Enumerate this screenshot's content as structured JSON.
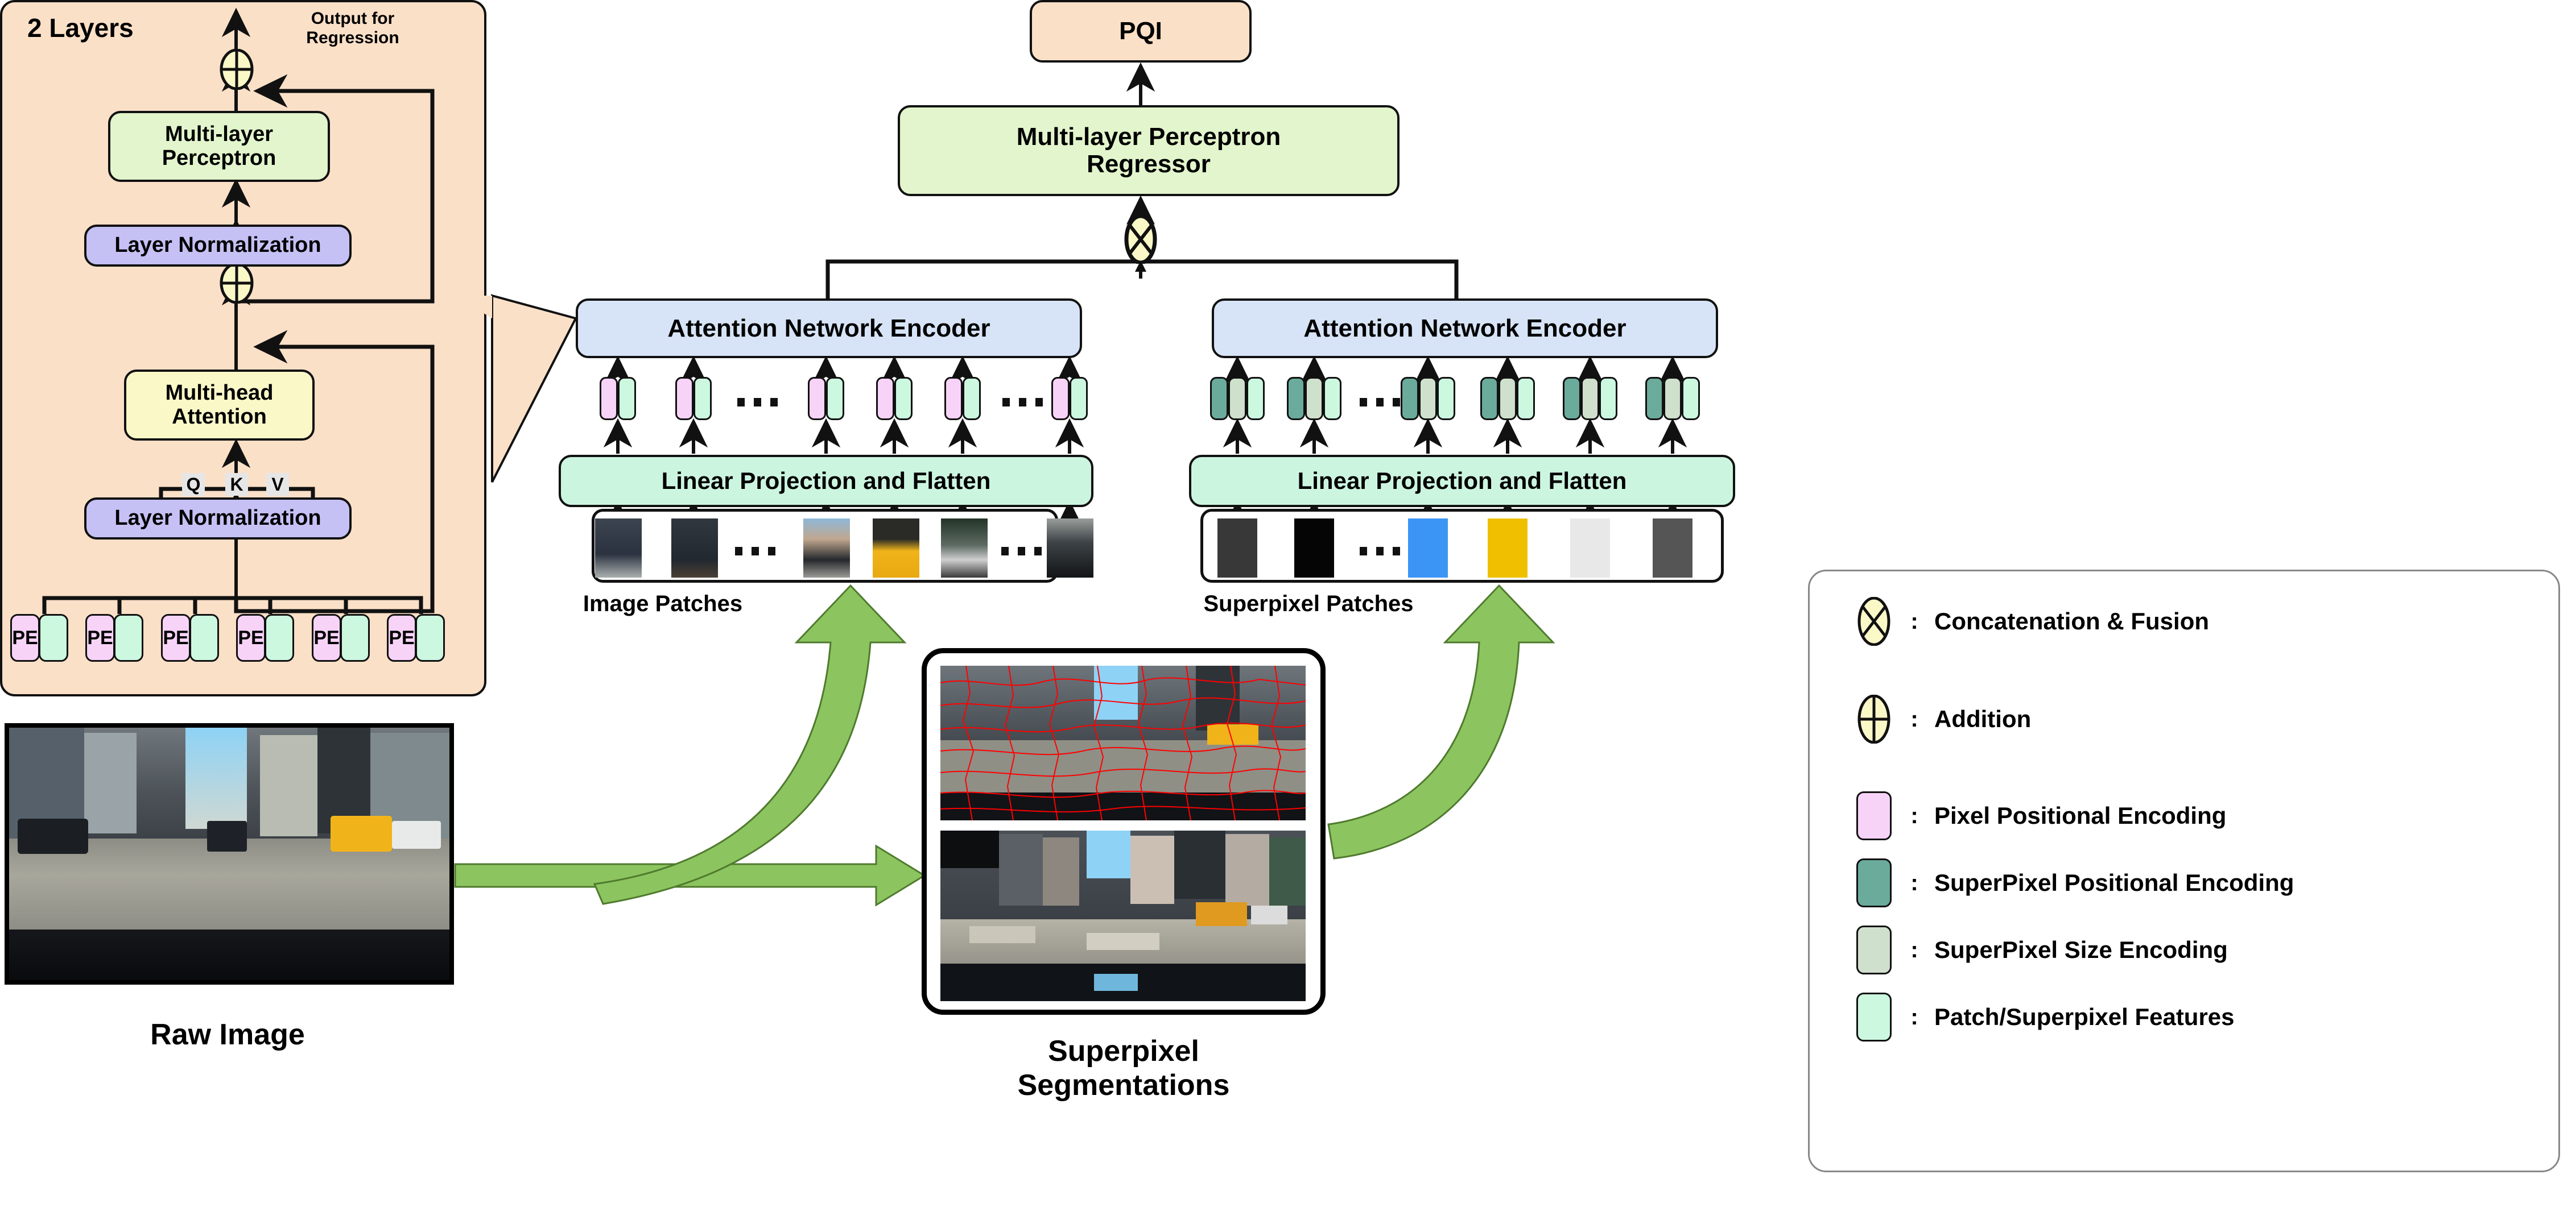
{
  "transformer_panel": {
    "title": "2 Layers",
    "output_label": "Output for\nRegression",
    "output_label_line1": "Output for",
    "output_label_line2": "Regression",
    "mlp": "Multi-layer\nPerceptron",
    "mlp_line1": "Multi-layer",
    "mlp_line2": "Perceptron",
    "layer_norm_top": "Layer Normalization",
    "multi_head_attention_line1": "Multi-head",
    "multi_head_attention_line2": "Attention",
    "layer_norm_bottom": "Layer Normalization",
    "qkv": [
      "Q",
      "K",
      "V"
    ],
    "pe_token_label": "PE",
    "pe_token_count": 6
  },
  "pipeline": {
    "pqi": "PQI",
    "mlp_regressor_line1": "Multi-layer Perceptron",
    "mlp_regressor_line2": "Regressor",
    "fusion_symbol": "concatenation-fusion",
    "encoder_left": "Attention Network Encoder",
    "encoder_right": "Attention Network Encoder",
    "linear_projection_left": "Linear Projection and Flatten",
    "linear_projection_right": "Linear Projection and Flatten",
    "image_patches_caption": "Image Patches",
    "superpixel_patches_caption": "Superpixel Patches",
    "left_token_count": 6,
    "right_token_count": 6,
    "superpixel_patch_colors": [
      "#383838",
      "#050505",
      "#3b95f5",
      "#f0c000",
      "#e8e8e8",
      "#555555"
    ]
  },
  "raw_image": {
    "caption": "Raw Image"
  },
  "superpixel_card": {
    "caption_line1": "Superpixel",
    "caption_line2": "Segmentations"
  },
  "legend": {
    "items": [
      {
        "symbol": "concatenation-fusion-icon",
        "colon": ":",
        "label": "Concatenation & Fusion",
        "color": "#fbf8c8"
      },
      {
        "symbol": "addition-icon",
        "colon": ":",
        "label": "Addition",
        "color": "#fbf8c8"
      },
      {
        "symbol": "swatch",
        "colon": ":",
        "label": "Pixel Positional Encoding",
        "color": "#f8d3f8"
      },
      {
        "symbol": "swatch",
        "colon": ":",
        "label": "SuperPixel Positional Encoding",
        "color": "#6aab9c"
      },
      {
        "symbol": "swatch",
        "colon": ":",
        "label": "SuperPixel Size Encoding",
        "color": "#cfe0cc"
      },
      {
        "symbol": "swatch",
        "colon": ":",
        "label": "Patch/Superpixel Features",
        "color": "#ccf8e0"
      }
    ]
  },
  "colors": {
    "panel_bg": "#fbe0c8",
    "mlp_green": "#e2f5cc",
    "layer_norm_lavender": "#c5c1f5",
    "attention_yellow": "#fbf8c8",
    "encoder_blue": "#d7e4f7",
    "projection_mint": "#ccf5e0",
    "pixel_pe_pink": "#f8d3f8",
    "feature_mint": "#ccf8e0",
    "superpixel_pe_teal": "#6aab9c",
    "superpixel_size_sage": "#cfe0cc",
    "flow_arrow_green": "#8cc55f",
    "segmentation_outline_red": "#ff0000"
  }
}
